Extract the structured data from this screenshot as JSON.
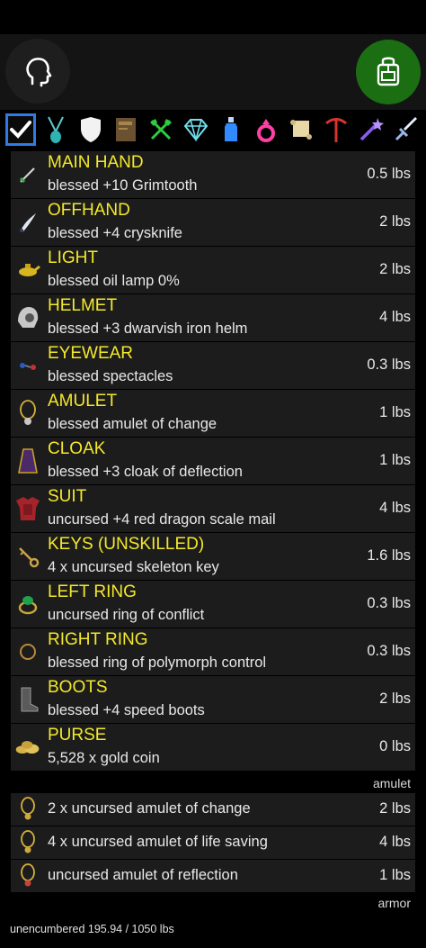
{
  "equipment": [
    {
      "slot": "MAIN HAND",
      "desc": "blessed +10 Grimtooth",
      "weight": "0.5 lbs",
      "icon": "dagger-icon"
    },
    {
      "slot": "OFFHAND",
      "desc": "blessed +4 crysknife",
      "weight": "2 lbs",
      "icon": "crysknife-icon"
    },
    {
      "slot": "LIGHT",
      "desc": "blessed oil lamp 0%",
      "weight": "2 lbs",
      "icon": "oil-lamp-icon"
    },
    {
      "slot": "HELMET",
      "desc": "blessed +3 dwarvish iron helm",
      "weight": "4 lbs",
      "icon": "helmet-icon"
    },
    {
      "slot": "EYEWEAR",
      "desc": "blessed spectacles",
      "weight": "0.3 lbs",
      "icon": "spectacles-icon"
    },
    {
      "slot": "AMULET",
      "desc": "blessed amulet of change",
      "weight": "1 lbs",
      "icon": "amulet-icon"
    },
    {
      "slot": "CLOAK",
      "desc": "blessed +3 cloak of deflection",
      "weight": "1 lbs",
      "icon": "cloak-icon"
    },
    {
      "slot": "SUIT",
      "desc": "uncursed +4 red dragon scale mail",
      "weight": "4 lbs",
      "icon": "armor-suit-icon"
    },
    {
      "slot": "KEYS (UNSKILLED)",
      "desc": "4 x uncursed skeleton key",
      "weight": "1.6 lbs",
      "icon": "key-icon"
    },
    {
      "slot": "LEFT RING",
      "desc": "uncursed ring of conflict",
      "weight": "0.3 lbs",
      "icon": "emerald-ring-icon"
    },
    {
      "slot": "RIGHT RING",
      "desc": "blessed ring of polymorph control",
      "weight": "0.3 lbs",
      "icon": "plain-ring-icon"
    },
    {
      "slot": "BOOTS",
      "desc": "blessed +4 speed boots",
      "weight": "2 lbs",
      "icon": "boots-icon"
    },
    {
      "slot": "PURSE",
      "desc": "5,528 x gold coin",
      "weight": "0 lbs",
      "icon": "gold-coins-icon"
    }
  ],
  "amulet_section": {
    "header": "amulet",
    "items": [
      {
        "desc": "2 x uncursed amulet of change",
        "weight": "2 lbs",
        "icon": "amulet-icon"
      },
      {
        "desc": "4 x uncursed amulet of life saving",
        "weight": "4 lbs",
        "icon": "amulet-icon"
      },
      {
        "desc": "uncursed amulet of reflection",
        "weight": "1 lbs",
        "icon": "amulet-icon"
      }
    ]
  },
  "armor_section": {
    "header": "armor"
  },
  "footer": {
    "status": "unencumbered 195.94 / 1050 lbs"
  },
  "tabs": [
    "check-icon",
    "amulet-icon",
    "shield-icon",
    "book-icon",
    "utensils-icon",
    "gem-icon",
    "potion-icon",
    "ring-icon",
    "scroll-icon",
    "pickaxe-icon",
    "wand-icon",
    "sword-icon"
  ],
  "colors": {
    "slot_label": "#f4e92a",
    "row_bg": "#1c1c1c",
    "accent_selected": "#2f7ae5",
    "backpack_button": "#1b6e12"
  }
}
